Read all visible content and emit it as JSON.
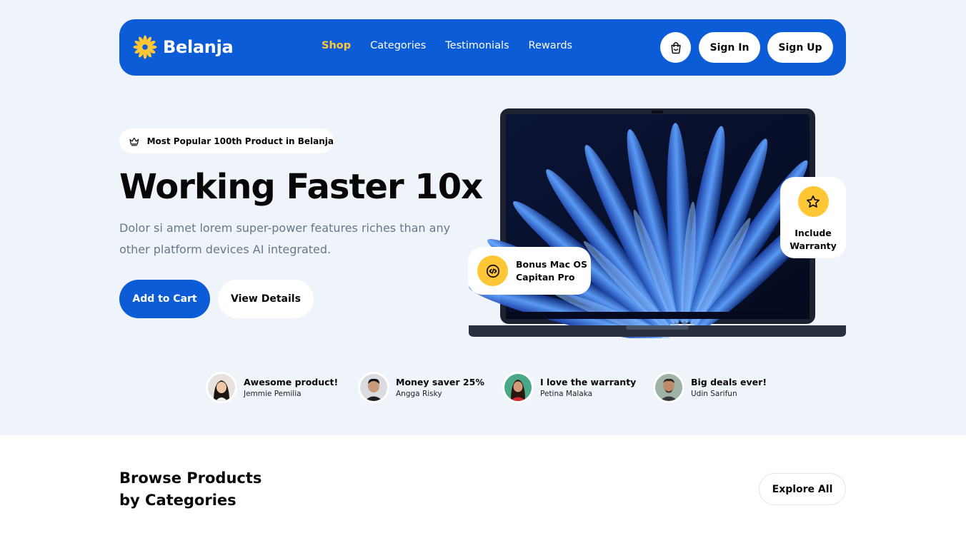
{
  "brand": {
    "name": "Belanja",
    "primary_color": "#0D5CD7",
    "accent_color": "#FFC736"
  },
  "nav": {
    "links": [
      {
        "label": "Shop",
        "active": true
      },
      {
        "label": "Categories",
        "active": false
      },
      {
        "label": "Testimonials",
        "active": false
      },
      {
        "label": "Rewards",
        "active": false
      }
    ],
    "cart_icon": "shopping-bag-icon",
    "signin_label": "Sign In",
    "signup_label": "Sign Up"
  },
  "hero": {
    "badge_icon": "crown-icon",
    "badge_text": "Most Popular 100th Product in Belanja",
    "title": "Working Faster 10x",
    "description": "Dolor si amet lorem super-power features riches than any other platform devices AI integrated.",
    "add_to_cart_label": "Add to Cart",
    "view_details_label": "View Details"
  },
  "product_cards": {
    "bonus": {
      "icon": "code-icon",
      "line1": "Bonus Mac OS",
      "line2": "Capitan Pro"
    },
    "warranty": {
      "icon": "star-icon",
      "line1": "Include",
      "line2": "Warranty"
    }
  },
  "testimonials": [
    {
      "quote": "Awesome product!",
      "name": "Jemmie Pemilia"
    },
    {
      "quote": "Money saver 25%",
      "name": "Angga Risky"
    },
    {
      "quote": "I love the warranty",
      "name": "Petina Malaka"
    },
    {
      "quote": "Big deals ever!",
      "name": "Udin Sarifun"
    }
  ],
  "browse": {
    "title_line1": "Browse Products",
    "title_line2": "by Categories",
    "explore_label": "Explore All"
  }
}
